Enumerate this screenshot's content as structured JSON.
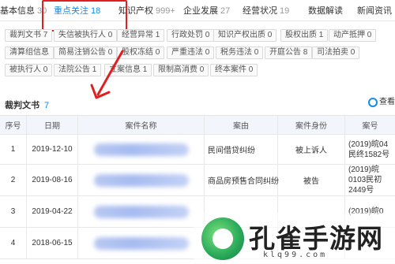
{
  "tabs": [
    {
      "label": "基本信息",
      "count": "30"
    },
    {
      "label": "重点关注",
      "count": "18"
    },
    {
      "label": "知识产权",
      "count": "999+"
    },
    {
      "label": "企业发展",
      "count": "27"
    },
    {
      "label": "经营状况",
      "count": "19"
    },
    {
      "label": "数据解读",
      "count": ""
    },
    {
      "label": "新闻资讯",
      "count": ""
    }
  ],
  "filter_chips": [
    "裁判文书 7",
    "失信被执行人 0",
    "经营异常 1",
    "行政处罚 0",
    "知识产权出质 0",
    "股权出质 1",
    "动产抵押 0",
    "清算组信息",
    "简易注销公告 0",
    "股权冻结 0",
    "严重违法 0",
    "税务违法 0",
    "开庭公告 8",
    "司法拍卖 0",
    "被执行人 0",
    "法院公告 1",
    "立案信息 1",
    "限制高消费 0",
    "终本案件 0"
  ],
  "section": {
    "title": "裁判文书",
    "count": "7",
    "view_label": "查看"
  },
  "table": {
    "headers": [
      "序号",
      "日期",
      "案件名称",
      "案由",
      "案件身份",
      "案号"
    ],
    "rows": [
      {
        "no": "1",
        "date": "2019-12-10",
        "cause": "民间借贷纠纷",
        "role": "被上诉人",
        "case_no": "(2019)皖04民终1582号"
      },
      {
        "no": "2",
        "date": "2019-08-16",
        "cause": "商品房预售合同纠纷",
        "role": "被告",
        "case_no": "(2019)皖0103民初2449号"
      },
      {
        "no": "3",
        "date": "2019-04-22",
        "cause": "",
        "role": "",
        "case_no": "(2019)皖0"
      },
      {
        "no": "4",
        "date": "2018-06-15",
        "cause": "",
        "role": "",
        "case_no": ""
      }
    ]
  },
  "watermark": {
    "title": "孔雀手游网",
    "url": "klq99.com"
  },
  "colors": {
    "accent": "#128bed",
    "highlight": "#e02020",
    "header_bg": "#f2f6fc"
  }
}
